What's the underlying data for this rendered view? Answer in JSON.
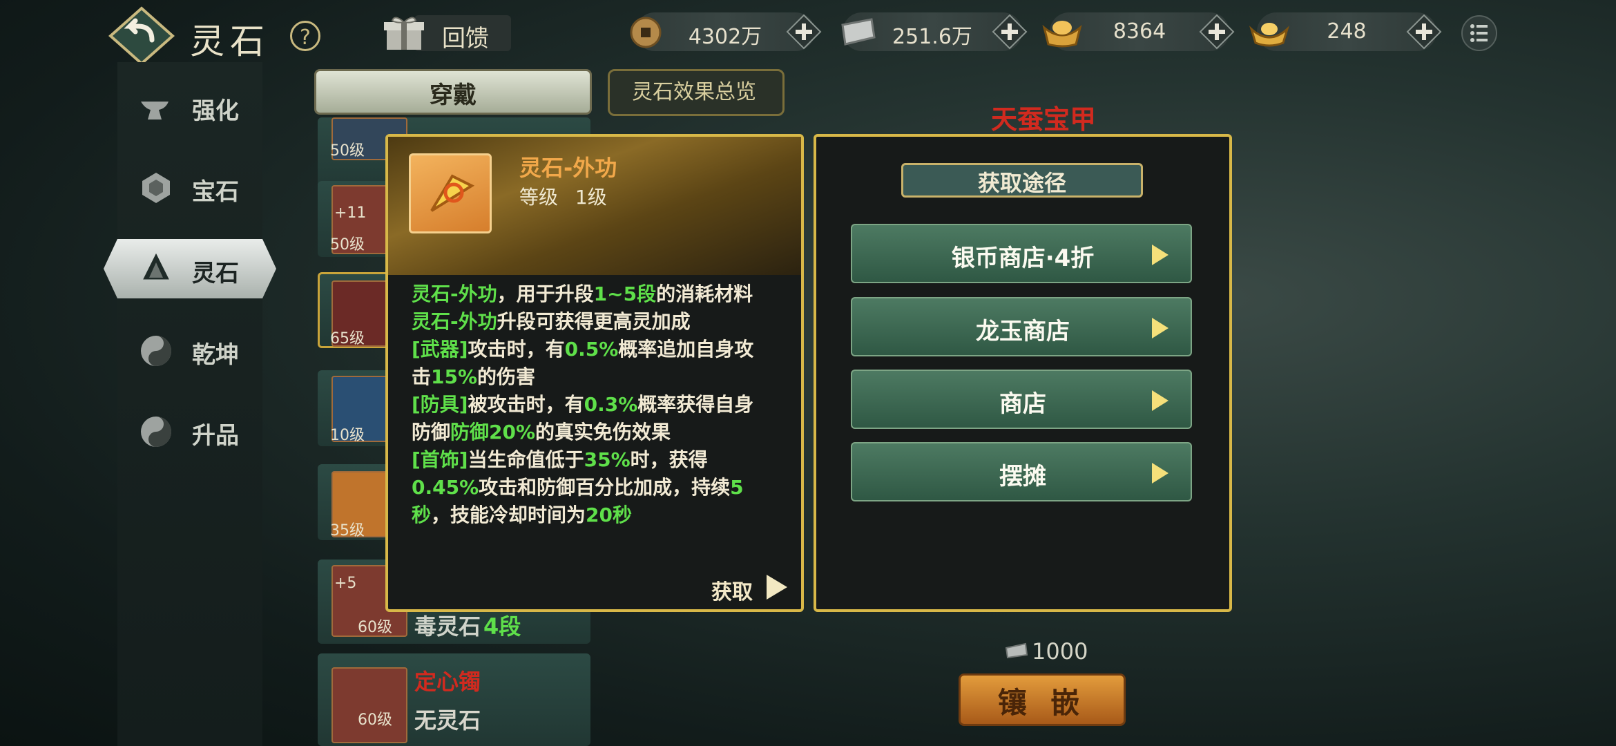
{
  "header": {
    "title": "灵石",
    "help_label": "?",
    "feedback_label": "回馈"
  },
  "currencies": [
    {
      "icon": "copper-coin-icon",
      "value": "4302万"
    },
    {
      "icon": "silver-ingot-icon",
      "value": "251.6万"
    },
    {
      "icon": "gold-ingot-icon",
      "value": "8364"
    },
    {
      "icon": "gold-yuanbao-icon",
      "value": "248"
    }
  ],
  "sidebar": {
    "items": [
      {
        "label": "强化",
        "icon": "anvil-icon"
      },
      {
        "label": "宝石",
        "icon": "gem-icon"
      },
      {
        "label": "灵石",
        "icon": "spirit-stone-icon",
        "active": true
      },
      {
        "label": "乾坤",
        "icon": "yin-yang-icon"
      },
      {
        "label": "升品",
        "icon": "yin-yang-icon"
      }
    ]
  },
  "tabs": {
    "wear": "穿戴",
    "overview": "灵石效果总览"
  },
  "list": [
    {
      "level": "50级"
    },
    {
      "level": "50级",
      "bonus": "+11"
    },
    {
      "level": "65级"
    },
    {
      "level": "10级"
    },
    {
      "level": "35级"
    },
    {
      "level": "60级",
      "bonus": "+5",
      "name": "毒灵石",
      "stage": "4段"
    },
    {
      "level": "60级",
      "name": "定心镯",
      "stone": "无灵石"
    }
  ],
  "equipment": {
    "name": "天蚕宝甲",
    "price": "1000",
    "inlay_button": "镶 嵌"
  },
  "item": {
    "name": "灵石-外功",
    "level_label": "等级",
    "level_value": "1级",
    "desc": {
      "l1_a": "灵石-外功",
      "l1_b": "，用于升段",
      "l1_c": "1~5段",
      "l1_d": "的消耗材料",
      "l2_a": "灵石-外功",
      "l2_b": "升段可获得更高灵加成",
      "l3_a": "[武器]",
      "l3_b": "攻击时，有",
      "l3_c": "0.5%",
      "l3_d": "概率追加自身攻",
      "l4_a": "击",
      "l4_b": "15%",
      "l4_c": "的伤害",
      "l5_a": "[防具]",
      "l5_b": "被攻击时，有",
      "l5_c": "0.3%",
      "l5_d": "概率获得自身",
      "l6_a": "防御",
      "l6_b": "防御20%",
      "l6_c": "的真实免伤效果",
      "l7_a": "[首饰]",
      "l7_b": "当生命值低于",
      "l7_c": "35%",
      "l7_d": "时，获得",
      "l8_a": "0.45%",
      "l8_b": "攻击和防御百分比加成，持续",
      "l8_c": "5",
      "l9_a": "秒",
      "l9_b": "，技能冷却时间为",
      "l9_c": "20秒"
    },
    "acquire_label": "获取"
  },
  "acquire_panel": {
    "title": "获取途径",
    "routes": [
      "银币商店·4折",
      "龙玉商店",
      "商店",
      "摆摊"
    ]
  },
  "colors": {
    "highlight_green": "#5fe04a",
    "item_title_orange": "#f2a84a",
    "panel_border_gold": "#d8b848",
    "route_button_green": "#3f6b53"
  }
}
